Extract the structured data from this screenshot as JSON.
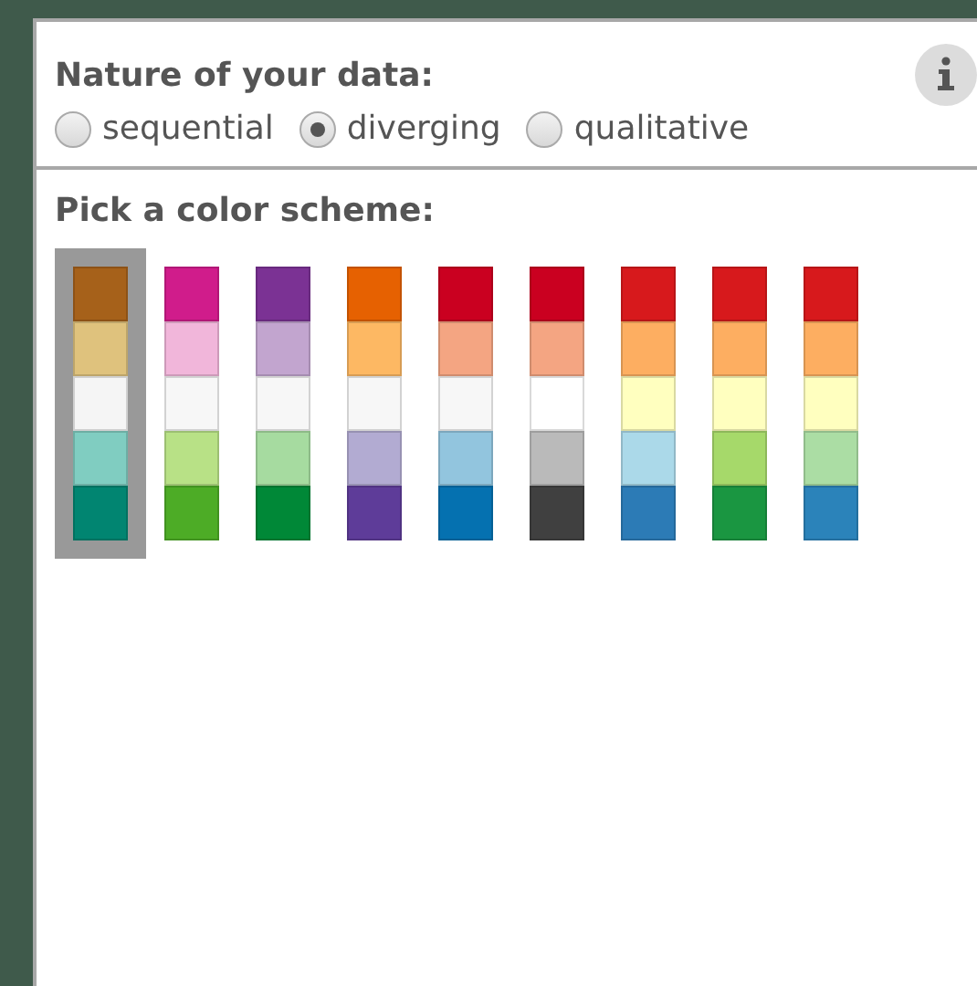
{
  "nature": {
    "heading": "Nature of your data:",
    "options": [
      {
        "label": "sequential",
        "selected": false
      },
      {
        "label": "diverging",
        "selected": true
      },
      {
        "label": "qualitative",
        "selected": false
      }
    ]
  },
  "schemes": {
    "heading": "Pick a color scheme:",
    "items": [
      {
        "selected": true,
        "swatches": [
          {
            "color": "#a6611a"
          },
          {
            "color": "#dfc27d"
          },
          {
            "color": "#f5f5f5"
          },
          {
            "color": "#80cdc1"
          },
          {
            "color": "#018571"
          }
        ]
      },
      {
        "selected": false,
        "swatches": [
          {
            "color": "#d01c8b"
          },
          {
            "color": "#f1b6da"
          },
          {
            "color": "#f7f7f7"
          },
          {
            "color": "#b8e186"
          },
          {
            "color": "#4dac26"
          }
        ]
      },
      {
        "selected": false,
        "swatches": [
          {
            "color": "#7b3294"
          },
          {
            "color": "#c2a5cf"
          },
          {
            "color": "#f7f7f7"
          },
          {
            "color": "#a6dba0"
          },
          {
            "color": "#008837"
          }
        ]
      },
      {
        "selected": false,
        "swatches": [
          {
            "color": "#e66101"
          },
          {
            "color": "#fdb863"
          },
          {
            "color": "#f7f7f7"
          },
          {
            "color": "#b2abd2"
          },
          {
            "color": "#5e3c99"
          }
        ]
      },
      {
        "selected": false,
        "swatches": [
          {
            "color": "#ca0020"
          },
          {
            "color": "#f4a582"
          },
          {
            "color": "#f7f7f7"
          },
          {
            "color": "#92c5de"
          },
          {
            "color": "#0571b0"
          }
        ]
      },
      {
        "selected": false,
        "swatches": [
          {
            "color": "#ca0020"
          },
          {
            "color": "#f4a582"
          },
          {
            "color": "#ffffff"
          },
          {
            "color": "#bababa"
          },
          {
            "color": "#404040"
          }
        ]
      },
      {
        "selected": false,
        "swatches": [
          {
            "color": "#d7191c"
          },
          {
            "color": "#fdae61"
          },
          {
            "color": "#ffffbf"
          },
          {
            "color": "#abd9e9"
          },
          {
            "color": "#2c7bb6"
          }
        ]
      },
      {
        "selected": false,
        "swatches": [
          {
            "color": "#d7191c"
          },
          {
            "color": "#fdae61"
          },
          {
            "color": "#ffffbf"
          },
          {
            "color": "#a6d96a"
          },
          {
            "color": "#1a9641"
          }
        ]
      },
      {
        "selected": false,
        "swatches": [
          {
            "color": "#d7191c"
          },
          {
            "color": "#fdae61"
          },
          {
            "color": "#ffffbf"
          },
          {
            "color": "#abdda4"
          },
          {
            "color": "#2b83ba"
          }
        ]
      }
    ]
  }
}
